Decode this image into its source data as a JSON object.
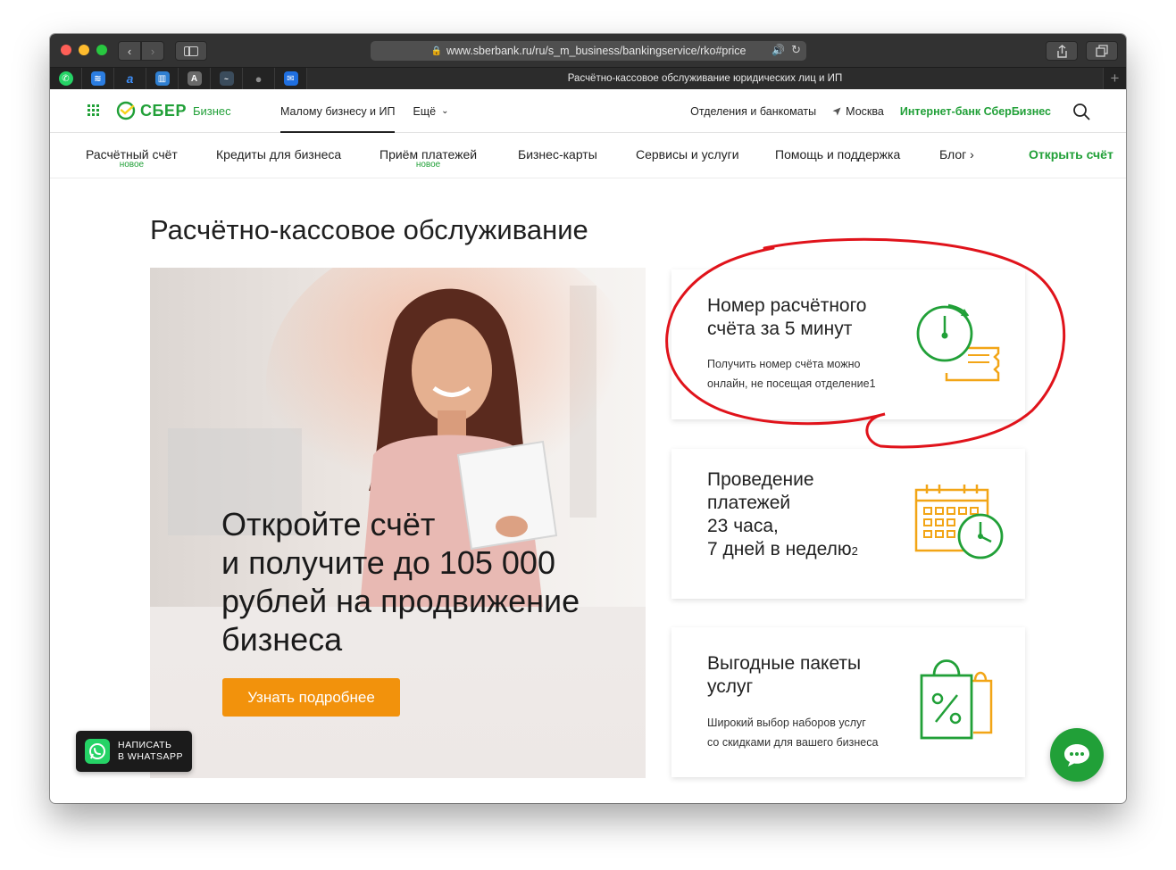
{
  "browser": {
    "url": "www.sberbank.ru/ru/s_m_business/bankingservice/rko#price",
    "tab_title": "Расчётно-кассовое обслуживание юридических лиц и ИП",
    "favicon_letter_a": "a",
    "favicon_letter_A": "A",
    "new_tab": "+"
  },
  "header": {
    "logo_text": "СБЕР",
    "logo_sub": "Бизнес",
    "nav": [
      {
        "label": "Малому бизнесу и ИП"
      },
      {
        "label": "Ещё"
      }
    ],
    "branches": "Отделения и банкоматы",
    "city": "Москва",
    "internet_bank": "Интернет-банк СберБизнес"
  },
  "main_nav": {
    "items": [
      {
        "label": "Расчётный счёт",
        "badge": "новое"
      },
      {
        "label": "Кредиты для бизнеса"
      },
      {
        "label": "Приём платежей",
        "badge": "новое"
      },
      {
        "label": "Бизнес-карты"
      },
      {
        "label": "Сервисы и услуги"
      },
      {
        "label": "Помощь и поддержка"
      },
      {
        "label": "Блог ›"
      }
    ],
    "cta": "Открыть счёт"
  },
  "page": {
    "title": "Расчётно-кассовое обслуживание",
    "hero": {
      "title_lines": [
        "Откройте счёт",
        "и получите до 105 000",
        "рублей на продвижение",
        "бизнеса"
      ],
      "button": "Узнать подробнее"
    },
    "cards": [
      {
        "title_lines": [
          "Номер расчётного",
          "счёта за 5 минут"
        ],
        "text_lines": [
          "Получить номер счёта можно",
          "онлайн, не посещая отделение"
        ],
        "footnote": "1",
        "icon": "clock-document-icon"
      },
      {
        "title_lines": [
          "Проведение",
          "платежей",
          "23 часа,",
          "7 дней в неделю"
        ],
        "footnote": "2",
        "icon": "calendar-clock-icon"
      },
      {
        "title_lines": [
          "Выгодные пакеты",
          "услуг"
        ],
        "text_lines": [
          "Широкий выбор наборов услуг",
          "со скидками для вашего бизнеса"
        ],
        "icon": "discount-bag-icon"
      }
    ]
  },
  "widgets": {
    "whatsapp_line1": "НАПИСАТЬ",
    "whatsapp_line2": "В WHATSAPP"
  },
  "colors": {
    "brand_green": "#21a038",
    "accent_orange": "#f2920c",
    "annotation_red": "#e0131b"
  }
}
